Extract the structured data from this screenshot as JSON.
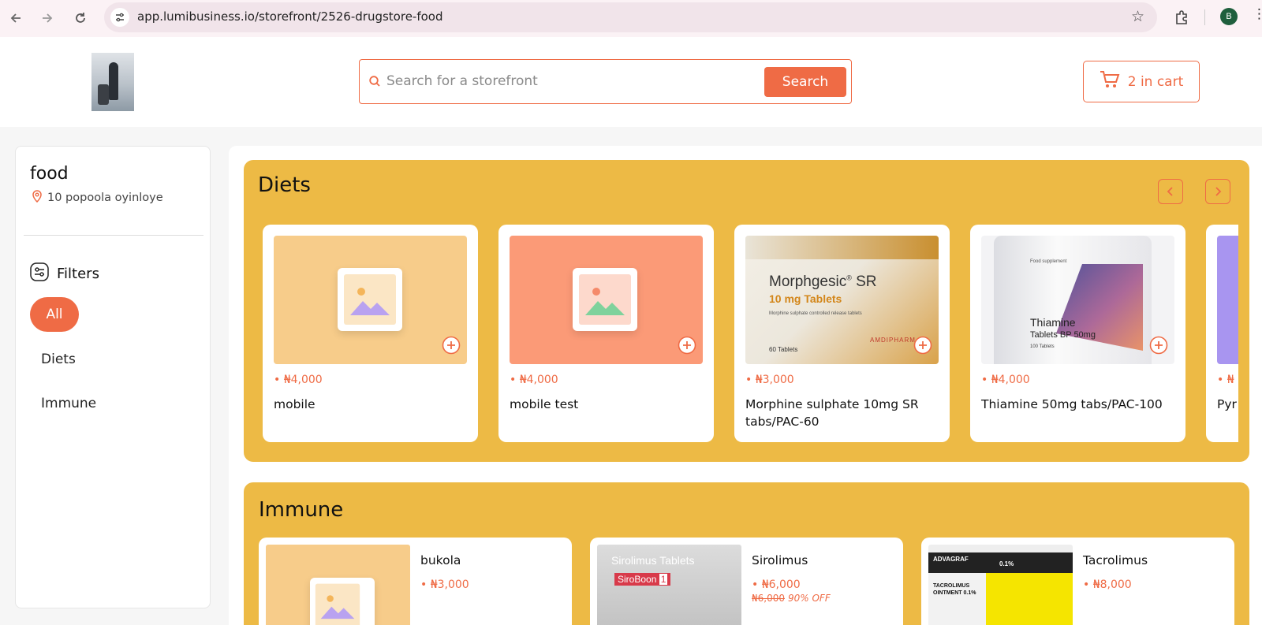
{
  "browser": {
    "url": "app.lumibusiness.io/storefront/2526-drugstore-food",
    "profile_initial": "B"
  },
  "header": {
    "search_placeholder": "Search for a storefront",
    "search_button": "Search",
    "cart_label": "2 in cart"
  },
  "store": {
    "name": "food",
    "address": "10 popoola oyinloye"
  },
  "filters": {
    "title": "Filters",
    "items": [
      "All",
      "Diets",
      "Immune"
    ],
    "active": "All"
  },
  "diets": {
    "title": "Diets",
    "products": [
      {
        "price": "₦4,000",
        "name": "mobile"
      },
      {
        "price": "₦4,000",
        "name": "mobile test"
      },
      {
        "price": "₦3,000",
        "name": "Morphine sulphate 10mg SR tabs/PAC-60",
        "img_brand": "Morphgesic",
        "img_sup": "®",
        "img_suffix": " SR",
        "img_dose": "10 mg Tablets",
        "img_desc": "Morphine sulphate controlled release tablets",
        "img_count": "60 Tablets",
        "img_maker": "AMDIPHARM"
      },
      {
        "price": "₦4,000",
        "name": "Thiamine 50mg tabs/PAC-100",
        "img_label": "Food supplement",
        "img_title": "Thiamine",
        "img_sub": "Tablets BP 50mg",
        "img_count": "100 Tablets"
      },
      {
        "price": "₦",
        "name": "Pyr"
      }
    ]
  },
  "immune": {
    "title": "Immune",
    "products": [
      {
        "name": "bukola",
        "price": "₦3,000"
      },
      {
        "name": "Sirolimus",
        "price": "₦6,000",
        "old_price": "₦6,000",
        "discount": "90% OFF",
        "img_title": "Sirolimus Tablets",
        "img_brand": "SiroBoon",
        "img_strength": "1"
      },
      {
        "name": "Tacrolimus",
        "price": "₦8,000",
        "img_brand": "ADVAGRAF",
        "img_title": "TACROLIMUS OINTMENT 0.1%",
        "img_strength": "0.1%"
      }
    ]
  },
  "colors": {
    "accent": "#ef6b45",
    "section_bg": "#edba45"
  }
}
